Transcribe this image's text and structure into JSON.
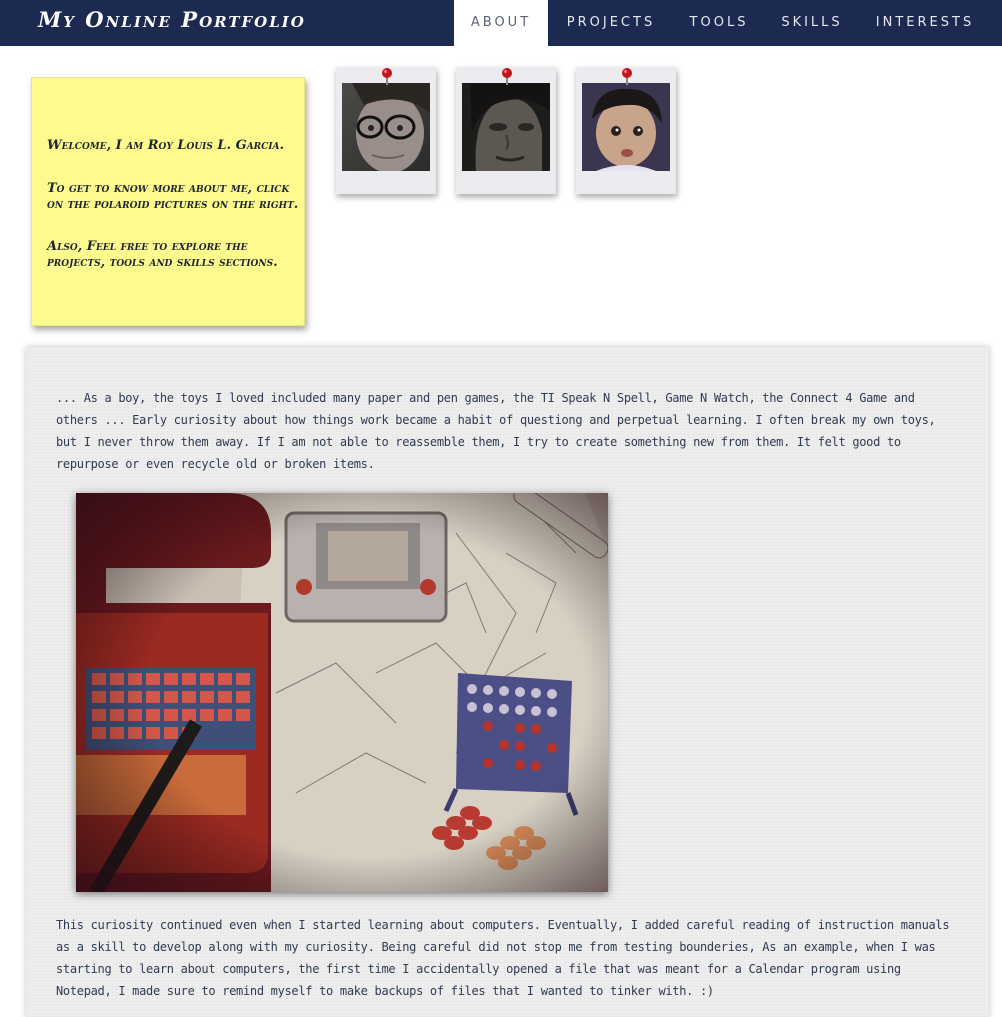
{
  "header": {
    "brand": "My Online Portfolio",
    "nav": [
      {
        "label": "ABOUT",
        "active": true
      },
      {
        "label": "PROJECTS",
        "active": false
      },
      {
        "label": "TOOLS",
        "active": false
      },
      {
        "label": "SKILLS",
        "active": false
      },
      {
        "label": "INTERESTS",
        "active": false
      }
    ]
  },
  "sticky_note": {
    "line1": "Welcome, I am Roy Louis L. Garcia.",
    "line2": "To get to know more about me, click on the polaroid pictures on the right.",
    "line3": "Also, Feel free to explore the projects, tools and skills sections."
  },
  "main": {
    "paragraph1": "... As a boy, the toys I loved included many paper and pen games, the TI Speak N Spell, Game N Watch, the Connect 4 Game and others ... Early curiosity about how things work became a habit of questiong and perpetual learning. I often break my own toys, but I never throw them away. If I am not able to reassemble them, I try to create something new from them. It felt good to repurpose or even recycle old or broken items.",
    "paragraph2": "This curiosity continued even when I started learning about computers. Eventually, I added careful reading of instruction manuals as a skill to develop along with my curiosity. Being careful did not stop me from testing bounderies, As an example, when I was starting to learn about computers, the first time I accidentally opened a file that was meant for a Calendar program using Notepad, I made sure to remind myself to make backups of files that I wanted to tinker with. :)"
  },
  "colors": {
    "navbar": "#1c2951",
    "sticky_note": "#fdfb8e",
    "paper": "#ececec",
    "pin": "#c0161c"
  }
}
